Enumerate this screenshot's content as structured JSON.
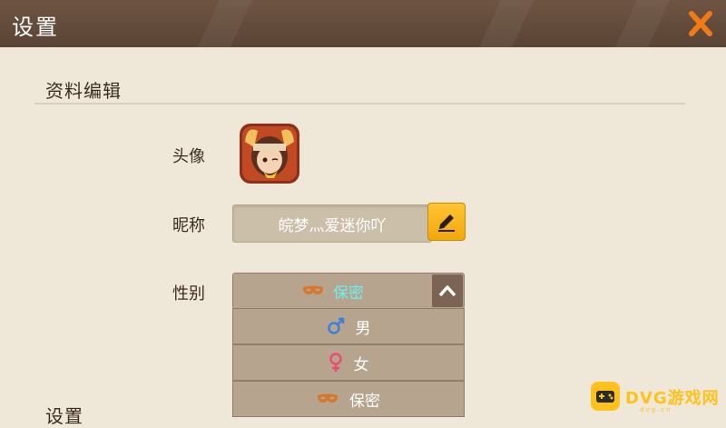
{
  "window": {
    "title": "设置"
  },
  "profile_section": {
    "title": "资料编辑"
  },
  "avatar": {
    "label": "头像"
  },
  "nickname": {
    "label": "昵称",
    "value": "皖梦灬爱迷你吖"
  },
  "gender": {
    "label": "性别",
    "selected": "保密",
    "options": [
      {
        "label": "男",
        "icon": "male-icon"
      },
      {
        "label": "女",
        "icon": "female-icon"
      },
      {
        "label": "保密",
        "icon": "mask-icon"
      }
    ]
  },
  "settings_section": {
    "title": "设置"
  },
  "watermark": {
    "text": "DVG游戏网",
    "sub": "dvg.cn"
  },
  "colors": {
    "titlebar": "#5e4738",
    "background": "#efe7d7",
    "accent_orange": "#f07a16",
    "edit_button": "#f6b21c",
    "selected_text": "#6cf0ef",
    "male": "#3f7fd6",
    "female": "#ea4e6f",
    "mask": "#d7782b"
  }
}
